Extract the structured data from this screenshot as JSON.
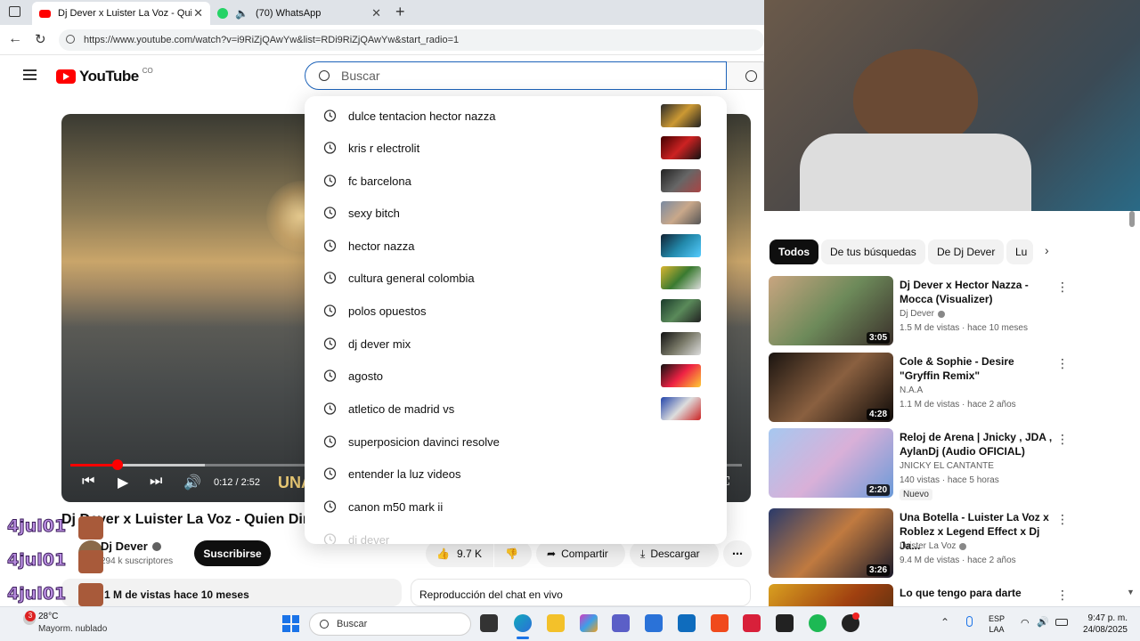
{
  "browser": {
    "tabs": [
      {
        "label": "Dj Dever x Luister La Voz - Quien",
        "active": true
      },
      {
        "label": "(70) WhatsApp",
        "active": false
      }
    ],
    "new_tab": "+",
    "url": "https://www.youtube.com/watch?v=i9RiZjQAwYw&list=RDi9RiZjQAwYw&start_radio=1"
  },
  "youtube": {
    "logo": "YouTube",
    "region": "CO",
    "search_placeholder": "Buscar",
    "suggestions": [
      "dulce tentacion hector nazza",
      "kris r electrolit",
      "fc barcelona",
      "sexy bitch",
      "hector nazza",
      "cultura general colombia",
      "polos opuestos",
      "dj dever mix",
      "agosto",
      "atletico de madrid vs",
      "superposicion davinci resolve",
      "entender la luz videos",
      "canon m50 mark ii",
      "dj dever"
    ],
    "player": {
      "time": "0:12 / 2:52",
      "progress": 0.07,
      "buffered": 0.2,
      "overlay_text": "UNA"
    },
    "video": {
      "title": "Dj Dever x Luister La Voz - Quien Diri",
      "channel": "Dj Dever",
      "subscribers": "294 k suscriptores",
      "subscribe_label": "Suscribirse",
      "likes": "9.7 K",
      "share_label": "Compartir",
      "download_label": "Descargar",
      "views_date": "1 M de vistas  hace 10 meses",
      "chat_label": "Reproducción del chat en vivo"
    },
    "chips": [
      "Todos",
      "De tus búsquedas",
      "De Dj Dever",
      "Lu"
    ],
    "related": [
      {
        "title": "Dj Dever x Hector Nazza - Mocca (Visualizer)",
        "channel": "Dj Dever",
        "meta": "1.5 M de vistas · hace 10 meses",
        "duration": "3:05",
        "badge": ""
      },
      {
        "title": "Cole & Sophie - Desire \"Gryffin Remix\"",
        "channel": "N.A.A",
        "meta": "1.1 M de vistas · hace 2 años",
        "duration": "4:28",
        "badge": ""
      },
      {
        "title": "Reloj de Arena | Jnicky , JDA , AylanDj (Audio OFICIAL)",
        "channel": "JNICKY EL CANTANTE",
        "meta": "140 vistas · hace 5 horas",
        "duration": "2:20",
        "badge": "Nuevo"
      },
      {
        "title": "Una Botella - Luister La Voz x Roblez x Legend Effect x Dj Ja...",
        "channel": "Luister La Voz",
        "meta": "9.4 M de vistas · hace 2 años",
        "duration": "3:26",
        "badge": ""
      },
      {
        "title": "Lo que tengo para darte",
        "channel": "",
        "meta": "",
        "duration": "",
        "badge": ""
      }
    ]
  },
  "overlay": {
    "chat_names": [
      "4jul01",
      "4jul01",
      "4jul01"
    ]
  },
  "taskbar": {
    "weather_temp": "28°C",
    "weather_desc": "Mayorm. nublado",
    "weather_badge": "3",
    "search_placeholder": "Buscar",
    "lang_top": "ESP",
    "lang_bottom": "LAA",
    "time": "9:47 p. m.",
    "date": "24/08/2025"
  }
}
